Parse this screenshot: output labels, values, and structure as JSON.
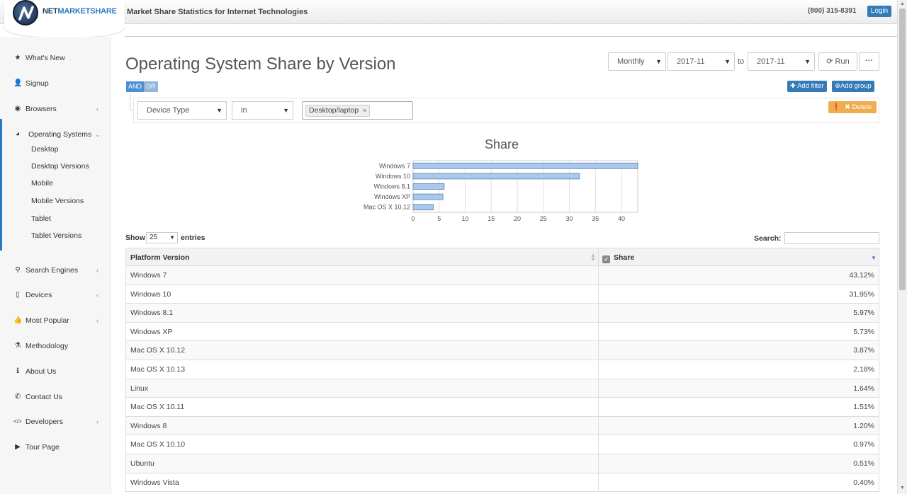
{
  "header": {
    "logo_net": "NET",
    "logo_ms": "MARKETSHARE",
    "tagline": "Market Share Statistics for Internet Technologies",
    "phone": "(800) 315-8391",
    "login": "Login"
  },
  "sidebar": {
    "items": [
      {
        "icon": "star-icon",
        "glyph": "★",
        "label": "What's New"
      },
      {
        "icon": "user-plus-icon",
        "glyph": "👤",
        "label": "Signup"
      },
      {
        "icon": "globe-icon",
        "glyph": "◉",
        "label": "Browsers"
      },
      {
        "icon": "pie-chart-icon",
        "glyph": "◕",
        "label": "Operating Systems"
      },
      {
        "icon": "search-icon",
        "glyph": "⚲",
        "label": "Search Engines"
      },
      {
        "icon": "tablet-icon",
        "glyph": "▯",
        "label": "Devices"
      },
      {
        "icon": "thumbs-up-icon",
        "glyph": "👍",
        "label": "Most Popular"
      },
      {
        "icon": "flask-icon",
        "glyph": "⚗",
        "label": "Methodology"
      },
      {
        "icon": "info-icon",
        "glyph": "ℹ",
        "label": "About Us"
      },
      {
        "icon": "phone-icon",
        "glyph": "✆",
        "label": "Contact Us"
      },
      {
        "icon": "code-icon",
        "glyph": "</>",
        "label": "Developers"
      },
      {
        "icon": "play-circle-icon",
        "glyph": "▶",
        "label": "Tour Page"
      }
    ],
    "sub_items": [
      "Desktop",
      "Desktop Versions",
      "Mobile",
      "Mobile Versions",
      "Tablet",
      "Tablet Versions"
    ]
  },
  "main": {
    "title": "Operating System Share by Version",
    "period": "Monthly",
    "from": "2017-11",
    "to_label": "to",
    "to": "2017-11",
    "run": "Run",
    "more": "···",
    "and": "AND",
    "or": "OR",
    "add_filter": "Add filter",
    "add_group": "Add group",
    "filter": {
      "field": "Device Type",
      "operator": "in",
      "value": "Desktop/laptop",
      "remove": "×"
    },
    "delete": "Delete"
  },
  "chart_data": {
    "type": "bar",
    "title": "Share",
    "categories": [
      "Windows 7",
      "Windows 10",
      "Windows 8.1",
      "Windows XP",
      "Mac OS X 10.12"
    ],
    "values": [
      43.12,
      31.95,
      5.97,
      5.73,
      3.87
    ],
    "xlim": [
      0,
      43.12
    ],
    "xticks": [
      0,
      5,
      10,
      15,
      20,
      25,
      30,
      35,
      40
    ],
    "orientation": "horizontal",
    "grid": true,
    "bar_color": "#a9c9ec"
  },
  "table": {
    "show_label": "Show",
    "page_size": "25",
    "entries_label": "entries",
    "search_label": "Search:",
    "headers": [
      "Platform Version",
      "Share"
    ],
    "rows": [
      [
        "Windows 7",
        "43.12%"
      ],
      [
        "Windows 10",
        "31.95%"
      ],
      [
        "Windows 8.1",
        "5.97%"
      ],
      [
        "Windows XP",
        "5.73%"
      ],
      [
        "Mac OS X 10.12",
        "3.87%"
      ],
      [
        "Mac OS X 10.13",
        "2.18%"
      ],
      [
        "Linux",
        "1.64%"
      ],
      [
        "Mac OS X 10.11",
        "1.51%"
      ],
      [
        "Windows 8",
        "1.20%"
      ],
      [
        "Mac OS X 10.10",
        "0.97%"
      ],
      [
        "Ubuntu",
        "0.51%"
      ],
      [
        "Windows Vista",
        "0.40%"
      ]
    ]
  }
}
